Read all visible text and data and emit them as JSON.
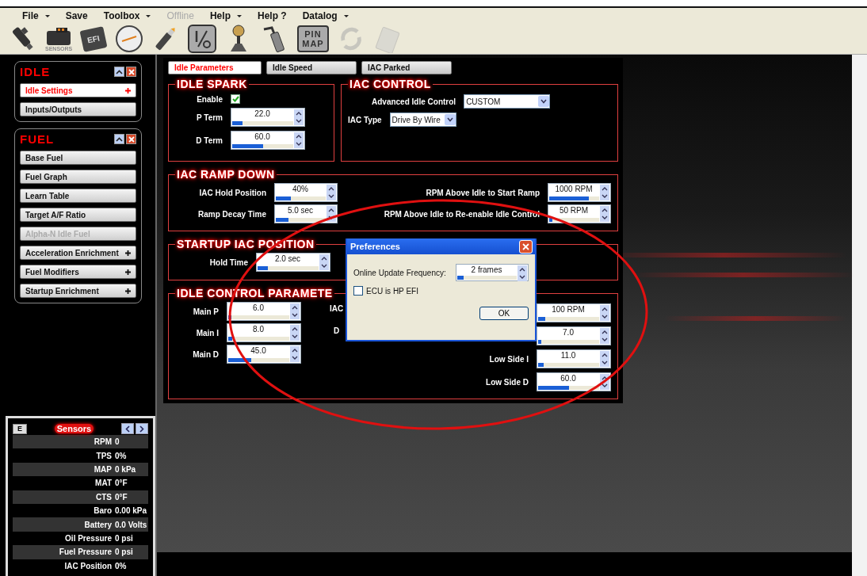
{
  "menu": [
    {
      "label": "File",
      "dropdown": true,
      "disabled": false
    },
    {
      "label": "Save",
      "dropdown": false,
      "disabled": false
    },
    {
      "label": "Toolbox",
      "dropdown": true,
      "disabled": false
    },
    {
      "label": "Offline",
      "dropdown": false,
      "disabled": true
    },
    {
      "label": "Help",
      "dropdown": true,
      "disabled": false
    },
    {
      "label": "Help ?",
      "dropdown": false,
      "disabled": false
    },
    {
      "label": "Datalog",
      "dropdown": true,
      "disabled": false
    }
  ],
  "toolbar": [
    {
      "kind": "injector",
      "disabled": false
    },
    {
      "kind": "sensors",
      "caption": "SENSORS",
      "disabled": false
    },
    {
      "kind": "ecu",
      "text": "EFI",
      "disabled": false
    },
    {
      "kind": "gauge",
      "disabled": false
    },
    {
      "kind": "plug",
      "disabled": false
    },
    {
      "kind": "io",
      "disabled": false
    },
    {
      "kind": "shifter",
      "disabled": false
    },
    {
      "kind": "pedal",
      "disabled": false
    },
    {
      "kind": "pinmap",
      "lines": [
        "PIN",
        "MAP"
      ],
      "disabled": false
    },
    {
      "kind": "refresh",
      "disabled": true
    },
    {
      "kind": "clipboard",
      "disabled": true
    }
  ],
  "sidebar": {
    "groups": [
      {
        "title": "IDLE",
        "items": [
          {
            "label": "Idle Settings",
            "selected": true,
            "disabled": false,
            "expandable": true
          },
          {
            "label": "Inputs/Outputs",
            "selected": false,
            "disabled": false,
            "expandable": false
          }
        ]
      },
      {
        "title": "FUEL",
        "items": [
          {
            "label": "Base Fuel",
            "selected": false,
            "disabled": false,
            "expandable": false
          },
          {
            "label": "Fuel Graph",
            "selected": false,
            "disabled": false,
            "expandable": false
          },
          {
            "label": "Learn Table",
            "selected": false,
            "disabled": false,
            "expandable": false
          },
          {
            "label": "Target A/F Ratio",
            "selected": false,
            "disabled": false,
            "expandable": false
          },
          {
            "label": "Alpha-N Idle Fuel",
            "selected": false,
            "disabled": true,
            "expandable": false
          },
          {
            "label": "Acceleration Enrichment",
            "selected": false,
            "disabled": false,
            "expandable": true
          },
          {
            "label": "Fuel Modifiers",
            "selected": false,
            "disabled": false,
            "expandable": true
          },
          {
            "label": "Startup Enrichment",
            "selected": false,
            "disabled": false,
            "expandable": true
          }
        ]
      }
    ]
  },
  "sensors": {
    "button": "E",
    "title": "Sensors",
    "rows": [
      {
        "name": "RPM",
        "value": "0"
      },
      {
        "name": "TPS",
        "value": "0%"
      },
      {
        "name": "MAP",
        "value": "0 kPa"
      },
      {
        "name": "MAT",
        "value": "0°F"
      },
      {
        "name": "CTS",
        "value": "0°F"
      },
      {
        "name": "Baro",
        "value": "0.00 kPa"
      },
      {
        "name": "Battery",
        "value": "0.0 Volts"
      },
      {
        "name": "Oil Pressure",
        "value": "0 psi"
      },
      {
        "name": "Fuel Pressure",
        "value": "0 psi"
      },
      {
        "name": "IAC Position",
        "value": "0%"
      }
    ]
  },
  "tabs": [
    {
      "label": "Idle Parameters",
      "selected": true
    },
    {
      "label": "Idle Speed",
      "selected": false
    },
    {
      "label": "IAC Parked",
      "selected": false
    }
  ],
  "idle_spark": {
    "title": "IDLE SPARK",
    "enable": {
      "label": "Enable",
      "checked": true
    },
    "fields": [
      {
        "label": "P Term",
        "value": "22.0",
        "level": 0.17
      },
      {
        "label": "D Term",
        "value": "60.0",
        "level": 0.5
      }
    ]
  },
  "iac_control": {
    "title": "IAC CONTROL",
    "selects": [
      {
        "label": "Advanced Idle Control",
        "value": "CUSTOM"
      },
      {
        "label": "IAC Type",
        "value": "Drive By Wire"
      }
    ]
  },
  "iac_ramp_down": {
    "title": "IAC RAMP DOWN",
    "left": [
      {
        "label": "IAC Hold Position",
        "value": "40%",
        "level": 0.3
      },
      {
        "label": "Ramp Decay Time",
        "value": "5.0 sec",
        "level": 0.25
      }
    ],
    "right": [
      {
        "label": "RPM Above Idle to Start Ramp",
        "value": "1000 RPM",
        "level": 0.8
      },
      {
        "label": "RPM Above Idle to Re-enable Idle Control",
        "value": "50 RPM",
        "level": 0.07
      }
    ]
  },
  "startup_iac_position": {
    "title": "STARTUP IAC POSITION",
    "fields": [
      {
        "label": "Hold Time",
        "value": "2.0 sec",
        "level": 0.17
      }
    ]
  },
  "idle_control_parameters": {
    "title": "IDLE CONTROL PARAMETE",
    "left": [
      {
        "label": "Main P",
        "value": "6.0",
        "level": 0.05
      },
      {
        "label": "Main I",
        "value": "8.0",
        "level": 0.07
      },
      {
        "label": "Main D",
        "value": "45.0",
        "level": 0.38
      }
    ],
    "middle_labels": [
      "IAC",
      "D"
    ],
    "right": [
      {
        "value": "100 RPM",
        "level": 0.12
      },
      {
        "value": "7.0",
        "level": 0.05
      },
      {
        "label": "Low Side I",
        "value": "11.0",
        "level": 0.09
      },
      {
        "label": "Low Side D",
        "value": "60.0",
        "level": 0.5
      }
    ]
  },
  "preferences_dialog": {
    "title": "Preferences",
    "field": {
      "label": "Online Update Frequency:",
      "value": "2 frames",
      "level": 0.1
    },
    "checkbox": {
      "label": "ECU is HP EFI",
      "checked": false
    },
    "button": "OK"
  }
}
